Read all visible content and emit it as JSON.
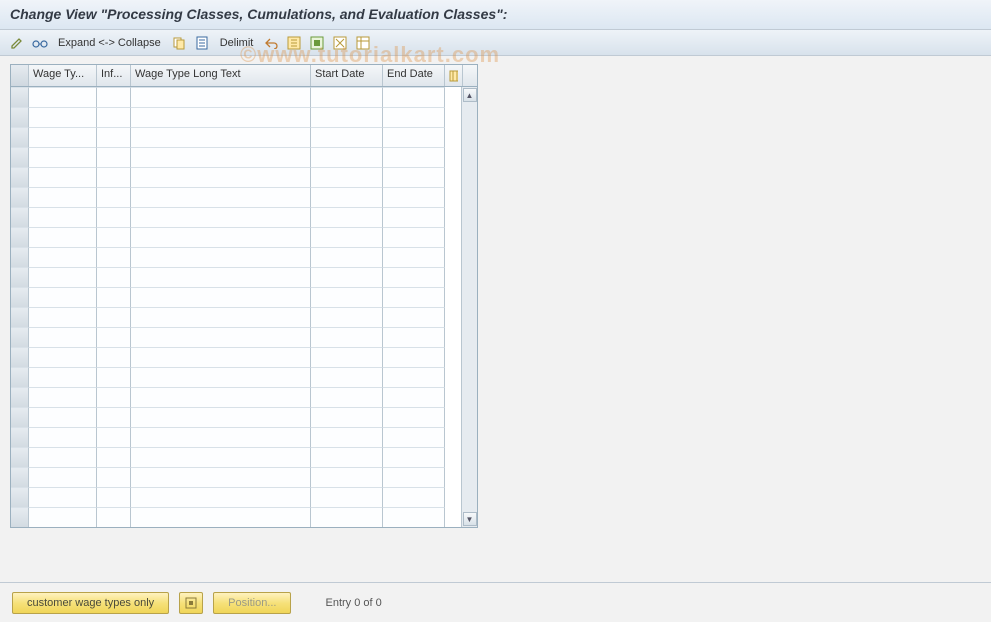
{
  "title": "Change View \"Processing Classes, Cumulations, and Evaluation Classes\":",
  "toolbar": {
    "expand_label": "Expand <-> Collapse",
    "delimit_label": "Delimit"
  },
  "watermark": "©www.tutorialkart.com",
  "table": {
    "headers": {
      "wage_type": "Wage Ty...",
      "inf": "Inf...",
      "long_text": "Wage Type Long Text",
      "start_date": "Start Date",
      "end_date": "End Date"
    },
    "rows": [
      {
        "wage_type": "",
        "inf": "",
        "long_text": "",
        "start_date": "",
        "end_date": ""
      },
      {
        "wage_type": "",
        "inf": "",
        "long_text": "",
        "start_date": "",
        "end_date": ""
      },
      {
        "wage_type": "",
        "inf": "",
        "long_text": "",
        "start_date": "",
        "end_date": ""
      },
      {
        "wage_type": "",
        "inf": "",
        "long_text": "",
        "start_date": "",
        "end_date": ""
      },
      {
        "wage_type": "",
        "inf": "",
        "long_text": "",
        "start_date": "",
        "end_date": ""
      },
      {
        "wage_type": "",
        "inf": "",
        "long_text": "",
        "start_date": "",
        "end_date": ""
      },
      {
        "wage_type": "",
        "inf": "",
        "long_text": "",
        "start_date": "",
        "end_date": ""
      },
      {
        "wage_type": "",
        "inf": "",
        "long_text": "",
        "start_date": "",
        "end_date": ""
      },
      {
        "wage_type": "",
        "inf": "",
        "long_text": "",
        "start_date": "",
        "end_date": ""
      },
      {
        "wage_type": "",
        "inf": "",
        "long_text": "",
        "start_date": "",
        "end_date": ""
      },
      {
        "wage_type": "",
        "inf": "",
        "long_text": "",
        "start_date": "",
        "end_date": ""
      },
      {
        "wage_type": "",
        "inf": "",
        "long_text": "",
        "start_date": "",
        "end_date": ""
      },
      {
        "wage_type": "",
        "inf": "",
        "long_text": "",
        "start_date": "",
        "end_date": ""
      },
      {
        "wage_type": "",
        "inf": "",
        "long_text": "",
        "start_date": "",
        "end_date": ""
      },
      {
        "wage_type": "",
        "inf": "",
        "long_text": "",
        "start_date": "",
        "end_date": ""
      },
      {
        "wage_type": "",
        "inf": "",
        "long_text": "",
        "start_date": "",
        "end_date": ""
      },
      {
        "wage_type": "",
        "inf": "",
        "long_text": "",
        "start_date": "",
        "end_date": ""
      },
      {
        "wage_type": "",
        "inf": "",
        "long_text": "",
        "start_date": "",
        "end_date": ""
      },
      {
        "wage_type": "",
        "inf": "",
        "long_text": "",
        "start_date": "",
        "end_date": ""
      },
      {
        "wage_type": "",
        "inf": "",
        "long_text": "",
        "start_date": "",
        "end_date": ""
      },
      {
        "wage_type": "",
        "inf": "",
        "long_text": "",
        "start_date": "",
        "end_date": ""
      },
      {
        "wage_type": "",
        "inf": "",
        "long_text": "",
        "start_date": "",
        "end_date": ""
      }
    ]
  },
  "footer": {
    "customer_btn": "customer wage types only",
    "position_btn": "Position...",
    "entry_text": "Entry 0 of 0"
  }
}
